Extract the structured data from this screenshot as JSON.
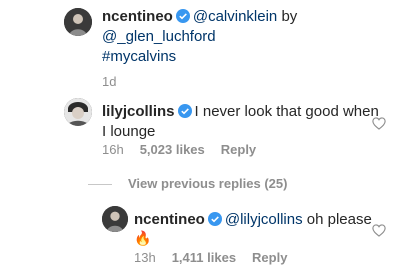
{
  "caption": {
    "username": "ncentineo",
    "line1_mention": "@calvinklein",
    "line1_by": "by",
    "line2_mention": "@_glen_luchford",
    "line3_hashtag": "#mycalvins",
    "time": "1d"
  },
  "comment1": {
    "username": "lilyjcollins",
    "text_line1": "I never look that good when",
    "text_line2": "I lounge",
    "time": "16h",
    "likes": "5,023 likes",
    "reply": "Reply"
  },
  "view_replies": "View previous replies (25)",
  "reply1": {
    "username": "ncentineo",
    "mention": "@lilyjcollins",
    "text": "oh please",
    "emoji": "🔥",
    "time": "13h",
    "likes": "1,411 likes",
    "reply": "Reply"
  },
  "colors": {
    "verified_blue": "#3897f0",
    "link_blue": "#003569",
    "meta_gray": "#8e8e8e"
  },
  "icons": {
    "verified": "verified-badge-icon",
    "heart": "heart-outline-icon"
  }
}
